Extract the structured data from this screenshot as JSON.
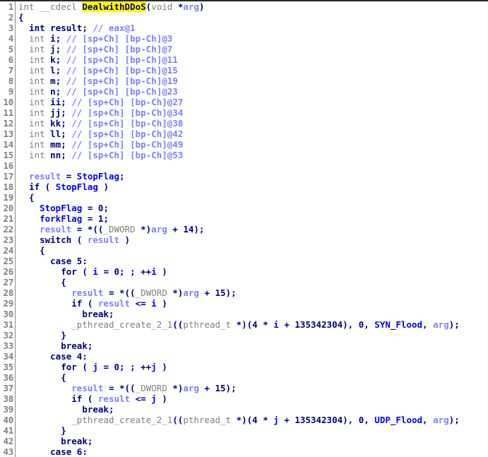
{
  "view": {
    "name": "hex-rays-pseudocode",
    "function_name": "DealwithDDoS",
    "highlighted_token": "DealwithDDoS",
    "first_line_number": 1,
    "last_line_number": 43,
    "colors": {
      "background": "#ffffff",
      "gutter_text": "#808080",
      "gutter_separator": "#8a8a8a",
      "keyword": "#000080",
      "type": "#808080",
      "local_variable": "#8080ff",
      "global_symbol": "#0000ff",
      "library_function": "#808080",
      "comment": "#8080ff",
      "number": "#000080",
      "highlight_background": "#ffff00",
      "top_border": "#2b2b2b"
    }
  },
  "lines": [
    {
      "n": "1",
      "tokens": [
        {
          "t": "int ",
          "c": "t-type"
        },
        {
          "t": "__cdecl ",
          "c": "t-type"
        },
        {
          "t": "DealwithDDoS",
          "c": "t-hl"
        },
        {
          "t": "(",
          "c": "t-plain"
        },
        {
          "t": "void ",
          "c": "t-type"
        },
        {
          "t": "*",
          "c": "t-plain"
        },
        {
          "t": "arg",
          "c": "t-localvar"
        },
        {
          "t": ")",
          "c": "t-plain"
        }
      ]
    },
    {
      "n": "2",
      "tokens": [
        {
          "t": "{",
          "c": "t-plain"
        }
      ]
    },
    {
      "n": "3",
      "tokens": [
        {
          "t": "  ",
          "c": "t-plain"
        },
        {
          "t": "int result;",
          "c": "t-decl"
        },
        {
          "t": " ",
          "c": "t-plain"
        },
        {
          "t": "// ",
          "c": "t-comment"
        },
        {
          "t": "eax@1",
          "c": "t-comment"
        }
      ]
    },
    {
      "n": "4",
      "tokens": [
        {
          "t": "  ",
          "c": "t-plain"
        },
        {
          "t": "int ",
          "c": "t-type"
        },
        {
          "t": "i;",
          "c": "t-decl"
        },
        {
          "t": " ",
          "c": "t-plain"
        },
        {
          "t": "// ",
          "c": "t-comment"
        },
        {
          "t": "[sp+Ch] [bp-Ch]@3",
          "c": "t-comment"
        }
      ]
    },
    {
      "n": "5",
      "tokens": [
        {
          "t": "  ",
          "c": "t-plain"
        },
        {
          "t": "int ",
          "c": "t-type"
        },
        {
          "t": "j;",
          "c": "t-decl"
        },
        {
          "t": " ",
          "c": "t-plain"
        },
        {
          "t": "// ",
          "c": "t-comment"
        },
        {
          "t": "[sp+Ch] [bp-Ch]@7",
          "c": "t-comment"
        }
      ]
    },
    {
      "n": "6",
      "tokens": [
        {
          "t": "  ",
          "c": "t-plain"
        },
        {
          "t": "int ",
          "c": "t-type"
        },
        {
          "t": "k;",
          "c": "t-decl"
        },
        {
          "t": " ",
          "c": "t-plain"
        },
        {
          "t": "// ",
          "c": "t-comment"
        },
        {
          "t": "[sp+Ch] [bp-Ch]@11",
          "c": "t-comment"
        }
      ]
    },
    {
      "n": "7",
      "tokens": [
        {
          "t": "  ",
          "c": "t-plain"
        },
        {
          "t": "int ",
          "c": "t-type"
        },
        {
          "t": "l;",
          "c": "t-decl"
        },
        {
          "t": " ",
          "c": "t-plain"
        },
        {
          "t": "// ",
          "c": "t-comment"
        },
        {
          "t": "[sp+Ch] [bp-Ch]@15",
          "c": "t-comment"
        }
      ]
    },
    {
      "n": "8",
      "tokens": [
        {
          "t": "  ",
          "c": "t-plain"
        },
        {
          "t": "int ",
          "c": "t-type"
        },
        {
          "t": "m;",
          "c": "t-decl"
        },
        {
          "t": " ",
          "c": "t-plain"
        },
        {
          "t": "// ",
          "c": "t-comment"
        },
        {
          "t": "[sp+Ch] [bp-Ch]@19",
          "c": "t-comment"
        }
      ]
    },
    {
      "n": "9",
      "tokens": [
        {
          "t": "  ",
          "c": "t-plain"
        },
        {
          "t": "int ",
          "c": "t-type"
        },
        {
          "t": "n;",
          "c": "t-decl"
        },
        {
          "t": " ",
          "c": "t-plain"
        },
        {
          "t": "// ",
          "c": "t-comment"
        },
        {
          "t": "[sp+Ch] [bp-Ch]@23",
          "c": "t-comment"
        }
      ]
    },
    {
      "n": "10",
      "tokens": [
        {
          "t": "  ",
          "c": "t-plain"
        },
        {
          "t": "int ",
          "c": "t-type"
        },
        {
          "t": "ii;",
          "c": "t-decl"
        },
        {
          "t": " ",
          "c": "t-plain"
        },
        {
          "t": "// ",
          "c": "t-comment"
        },
        {
          "t": "[sp+Ch] [bp-Ch]@27",
          "c": "t-comment"
        }
      ]
    },
    {
      "n": "11",
      "tokens": [
        {
          "t": "  ",
          "c": "t-plain"
        },
        {
          "t": "int ",
          "c": "t-type"
        },
        {
          "t": "jj;",
          "c": "t-decl"
        },
        {
          "t": " ",
          "c": "t-plain"
        },
        {
          "t": "// ",
          "c": "t-comment"
        },
        {
          "t": "[sp+Ch] [bp-Ch]@34",
          "c": "t-comment"
        }
      ]
    },
    {
      "n": "12",
      "tokens": [
        {
          "t": "  ",
          "c": "t-plain"
        },
        {
          "t": "int ",
          "c": "t-type"
        },
        {
          "t": "kk;",
          "c": "t-decl"
        },
        {
          "t": " ",
          "c": "t-plain"
        },
        {
          "t": "// ",
          "c": "t-comment"
        },
        {
          "t": "[sp+Ch] [bp-Ch]@38",
          "c": "t-comment"
        }
      ]
    },
    {
      "n": "13",
      "tokens": [
        {
          "t": "  ",
          "c": "t-plain"
        },
        {
          "t": "int ",
          "c": "t-type"
        },
        {
          "t": "ll;",
          "c": "t-decl"
        },
        {
          "t": " ",
          "c": "t-plain"
        },
        {
          "t": "// ",
          "c": "t-comment"
        },
        {
          "t": "[sp+Ch] [bp-Ch]@42",
          "c": "t-comment"
        }
      ]
    },
    {
      "n": "14",
      "tokens": [
        {
          "t": "  ",
          "c": "t-plain"
        },
        {
          "t": "int ",
          "c": "t-type"
        },
        {
          "t": "mm;",
          "c": "t-decl"
        },
        {
          "t": " ",
          "c": "t-plain"
        },
        {
          "t": "// ",
          "c": "t-comment"
        },
        {
          "t": "[sp+Ch] [bp-Ch]@49",
          "c": "t-comment"
        }
      ]
    },
    {
      "n": "15",
      "tokens": [
        {
          "t": "  ",
          "c": "t-plain"
        },
        {
          "t": "int ",
          "c": "t-type"
        },
        {
          "t": "nn;",
          "c": "t-decl"
        },
        {
          "t": " ",
          "c": "t-plain"
        },
        {
          "t": "// ",
          "c": "t-comment"
        },
        {
          "t": "[sp+Ch] [bp-Ch]@53",
          "c": "t-comment"
        }
      ]
    },
    {
      "n": "16",
      "tokens": [
        {
          "t": "",
          "c": "t-plain"
        }
      ]
    },
    {
      "n": "17",
      "tokens": [
        {
          "t": "  ",
          "c": "t-plain"
        },
        {
          "t": "result",
          "c": "t-localvar"
        },
        {
          "t": " = ",
          "c": "t-plain"
        },
        {
          "t": "StopFlag",
          "c": "t-global"
        },
        {
          "t": ";",
          "c": "t-plain"
        }
      ]
    },
    {
      "n": "18",
      "tokens": [
        {
          "t": "  ",
          "c": "t-plain"
        },
        {
          "t": "if ",
          "c": "t-keyword"
        },
        {
          "t": "( ",
          "c": "t-plain"
        },
        {
          "t": "StopFlag",
          "c": "t-global"
        },
        {
          "t": " )",
          "c": "t-plain"
        }
      ]
    },
    {
      "n": "19",
      "tokens": [
        {
          "t": "  {",
          "c": "t-plain"
        }
      ]
    },
    {
      "n": "20",
      "tokens": [
        {
          "t": "    ",
          "c": "t-plain"
        },
        {
          "t": "StopFlag",
          "c": "t-global"
        },
        {
          "t": " = ",
          "c": "t-plain"
        },
        {
          "t": "0",
          "c": "t-number"
        },
        {
          "t": ";",
          "c": "t-plain"
        }
      ]
    },
    {
      "n": "21",
      "tokens": [
        {
          "t": "    ",
          "c": "t-plain"
        },
        {
          "t": "forkFlag",
          "c": "t-global"
        },
        {
          "t": " = ",
          "c": "t-plain"
        },
        {
          "t": "1",
          "c": "t-number"
        },
        {
          "t": ";",
          "c": "t-plain"
        }
      ]
    },
    {
      "n": "22",
      "tokens": [
        {
          "t": "    ",
          "c": "t-plain"
        },
        {
          "t": "result",
          "c": "t-localvar"
        },
        {
          "t": " = *((",
          "c": "t-plain"
        },
        {
          "t": "_DWORD ",
          "c": "t-type"
        },
        {
          "t": "*)",
          "c": "t-plain"
        },
        {
          "t": "arg",
          "c": "t-localvar"
        },
        {
          "t": " + ",
          "c": "t-plain"
        },
        {
          "t": "14",
          "c": "t-number"
        },
        {
          "t": ");",
          "c": "t-plain"
        }
      ]
    },
    {
      "n": "23",
      "tokens": [
        {
          "t": "    ",
          "c": "t-plain"
        },
        {
          "t": "switch ",
          "c": "t-keyword"
        },
        {
          "t": "( ",
          "c": "t-plain"
        },
        {
          "t": "result",
          "c": "t-localvar"
        },
        {
          "t": " )",
          "c": "t-plain"
        }
      ]
    },
    {
      "n": "24",
      "tokens": [
        {
          "t": "    {",
          "c": "t-plain"
        }
      ]
    },
    {
      "n": "25",
      "tokens": [
        {
          "t": "      ",
          "c": "t-plain"
        },
        {
          "t": "case ",
          "c": "t-keyword"
        },
        {
          "t": "5",
          "c": "t-number"
        },
        {
          "t": ":",
          "c": "t-plain"
        }
      ]
    },
    {
      "n": "26",
      "tokens": [
        {
          "t": "        ",
          "c": "t-plain"
        },
        {
          "t": "for ",
          "c": "t-keyword"
        },
        {
          "t": "( ",
          "c": "t-plain"
        },
        {
          "t": "i",
          "c": "t-var"
        },
        {
          "t": " = ",
          "c": "t-plain"
        },
        {
          "t": "0",
          "c": "t-number"
        },
        {
          "t": "; ; ++",
          "c": "t-plain"
        },
        {
          "t": "i",
          "c": "t-var"
        },
        {
          "t": " )",
          "c": "t-plain"
        }
      ]
    },
    {
      "n": "27",
      "tokens": [
        {
          "t": "        {",
          "c": "t-plain"
        }
      ]
    },
    {
      "n": "28",
      "tokens": [
        {
          "t": "          ",
          "c": "t-plain"
        },
        {
          "t": "result",
          "c": "t-localvar"
        },
        {
          "t": " = *((",
          "c": "t-plain"
        },
        {
          "t": "_DWORD ",
          "c": "t-type"
        },
        {
          "t": "*)",
          "c": "t-plain"
        },
        {
          "t": "arg",
          "c": "t-localvar"
        },
        {
          "t": " + ",
          "c": "t-plain"
        },
        {
          "t": "15",
          "c": "t-number"
        },
        {
          "t": ");",
          "c": "t-plain"
        }
      ]
    },
    {
      "n": "29",
      "tokens": [
        {
          "t": "          ",
          "c": "t-plain"
        },
        {
          "t": "if ",
          "c": "t-keyword"
        },
        {
          "t": "( ",
          "c": "t-plain"
        },
        {
          "t": "result",
          "c": "t-localvar"
        },
        {
          "t": " <= ",
          "c": "t-plain"
        },
        {
          "t": "i",
          "c": "t-var"
        },
        {
          "t": " )",
          "c": "t-plain"
        }
      ]
    },
    {
      "n": "30",
      "tokens": [
        {
          "t": "            ",
          "c": "t-plain"
        },
        {
          "t": "break",
          "c": "t-keyword"
        },
        {
          "t": ";",
          "c": "t-plain"
        }
      ]
    },
    {
      "n": "31",
      "tokens": [
        {
          "t": "          ",
          "c": "t-plain"
        },
        {
          "t": "_pthread_create_2_1",
          "c": "t-libfunc"
        },
        {
          "t": "((",
          "c": "t-plain"
        },
        {
          "t": "pthread_t ",
          "c": "t-type"
        },
        {
          "t": "*)(",
          "c": "t-plain"
        },
        {
          "t": "4",
          "c": "t-number"
        },
        {
          "t": " * ",
          "c": "t-plain"
        },
        {
          "t": "i",
          "c": "t-var"
        },
        {
          "t": " + ",
          "c": "t-plain"
        },
        {
          "t": "135342304",
          "c": "t-number"
        },
        {
          "t": "), ",
          "c": "t-plain"
        },
        {
          "t": "0",
          "c": "t-number"
        },
        {
          "t": ", ",
          "c": "t-plain"
        },
        {
          "t": "SYN_Flood",
          "c": "t-global"
        },
        {
          "t": ", ",
          "c": "t-plain"
        },
        {
          "t": "arg",
          "c": "t-localvar"
        },
        {
          "t": ");",
          "c": "t-plain"
        }
      ]
    },
    {
      "n": "32",
      "tokens": [
        {
          "t": "        }",
          "c": "t-plain"
        }
      ]
    },
    {
      "n": "33",
      "tokens": [
        {
          "t": "        ",
          "c": "t-plain"
        },
        {
          "t": "break",
          "c": "t-keyword"
        },
        {
          "t": ";",
          "c": "t-plain"
        }
      ]
    },
    {
      "n": "34",
      "tokens": [
        {
          "t": "      ",
          "c": "t-plain"
        },
        {
          "t": "case ",
          "c": "t-keyword"
        },
        {
          "t": "4",
          "c": "t-number"
        },
        {
          "t": ":",
          "c": "t-plain"
        }
      ]
    },
    {
      "n": "35",
      "tokens": [
        {
          "t": "        ",
          "c": "t-plain"
        },
        {
          "t": "for ",
          "c": "t-keyword"
        },
        {
          "t": "( ",
          "c": "t-plain"
        },
        {
          "t": "j",
          "c": "t-var"
        },
        {
          "t": " = ",
          "c": "t-plain"
        },
        {
          "t": "0",
          "c": "t-number"
        },
        {
          "t": "; ; ++",
          "c": "t-plain"
        },
        {
          "t": "j",
          "c": "t-var"
        },
        {
          "t": " )",
          "c": "t-plain"
        }
      ]
    },
    {
      "n": "36",
      "tokens": [
        {
          "t": "        {",
          "c": "t-plain"
        }
      ]
    },
    {
      "n": "37",
      "tokens": [
        {
          "t": "          ",
          "c": "t-plain"
        },
        {
          "t": "result",
          "c": "t-localvar"
        },
        {
          "t": " = *((",
          "c": "t-plain"
        },
        {
          "t": "_DWORD ",
          "c": "t-type"
        },
        {
          "t": "*)",
          "c": "t-plain"
        },
        {
          "t": "arg",
          "c": "t-localvar"
        },
        {
          "t": " + ",
          "c": "t-plain"
        },
        {
          "t": "15",
          "c": "t-number"
        },
        {
          "t": ");",
          "c": "t-plain"
        }
      ]
    },
    {
      "n": "38",
      "tokens": [
        {
          "t": "          ",
          "c": "t-plain"
        },
        {
          "t": "if ",
          "c": "t-keyword"
        },
        {
          "t": "( ",
          "c": "t-plain"
        },
        {
          "t": "result",
          "c": "t-localvar"
        },
        {
          "t": " <= ",
          "c": "t-plain"
        },
        {
          "t": "j",
          "c": "t-var"
        },
        {
          "t": " )",
          "c": "t-plain"
        }
      ]
    },
    {
      "n": "39",
      "tokens": [
        {
          "t": "            ",
          "c": "t-plain"
        },
        {
          "t": "break",
          "c": "t-keyword"
        },
        {
          "t": ";",
          "c": "t-plain"
        }
      ]
    },
    {
      "n": "40",
      "tokens": [
        {
          "t": "          ",
          "c": "t-plain"
        },
        {
          "t": "_pthread_create_2_1",
          "c": "t-libfunc"
        },
        {
          "t": "((",
          "c": "t-plain"
        },
        {
          "t": "pthread_t ",
          "c": "t-type"
        },
        {
          "t": "*)(",
          "c": "t-plain"
        },
        {
          "t": "4",
          "c": "t-number"
        },
        {
          "t": " * ",
          "c": "t-plain"
        },
        {
          "t": "j",
          "c": "t-var"
        },
        {
          "t": " + ",
          "c": "t-plain"
        },
        {
          "t": "135342304",
          "c": "t-number"
        },
        {
          "t": "), ",
          "c": "t-plain"
        },
        {
          "t": "0",
          "c": "t-number"
        },
        {
          "t": ", ",
          "c": "t-plain"
        },
        {
          "t": "UDP_Flood",
          "c": "t-global"
        },
        {
          "t": ", ",
          "c": "t-plain"
        },
        {
          "t": "arg",
          "c": "t-localvar"
        },
        {
          "t": ");",
          "c": "t-plain"
        }
      ]
    },
    {
      "n": "41",
      "tokens": [
        {
          "t": "        }",
          "c": "t-plain"
        }
      ]
    },
    {
      "n": "42",
      "tokens": [
        {
          "t": "        ",
          "c": "t-plain"
        },
        {
          "t": "break",
          "c": "t-keyword"
        },
        {
          "t": ";",
          "c": "t-plain"
        }
      ]
    },
    {
      "n": "43",
      "tokens": [
        {
          "t": "      ",
          "c": "t-plain"
        },
        {
          "t": "case ",
          "c": "t-keyword"
        },
        {
          "t": "6",
          "c": "t-number"
        },
        {
          "t": ":",
          "c": "t-plain"
        }
      ]
    }
  ]
}
